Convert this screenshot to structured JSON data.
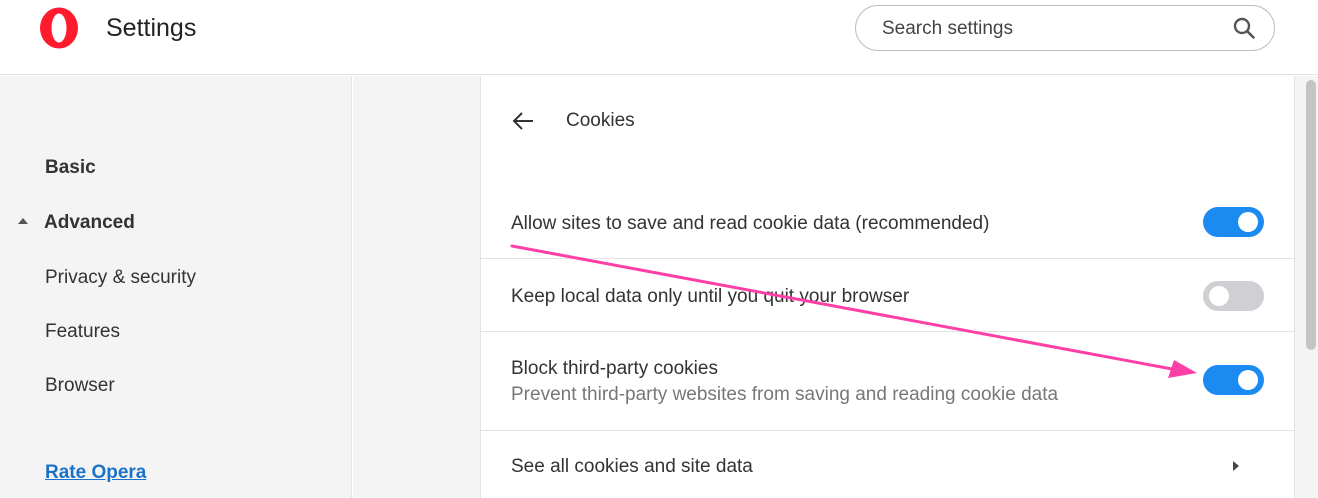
{
  "header": {
    "title": "Settings",
    "search": {
      "placeholder": "Search settings",
      "value": ""
    }
  },
  "sidebar": {
    "items": [
      {
        "label": "Basic"
      },
      {
        "label": "Advanced",
        "expanded": true
      },
      {
        "label": "Privacy & security"
      },
      {
        "label": "Features"
      },
      {
        "label": "Browser"
      }
    ],
    "rate_link": "Rate Opera"
  },
  "page": {
    "title": "Cookies",
    "settings": [
      {
        "label": "Allow sites to save and read cookie data (recommended)",
        "enabled": true
      },
      {
        "label": "Keep local data only until you quit your browser",
        "enabled": false
      },
      {
        "label": "Block third-party cookies",
        "description": "Prevent third-party websites from saving and reading cookie data",
        "enabled": true
      }
    ],
    "see_all_label": "See all cookies and site data"
  },
  "colors": {
    "accent": "#1b8bf2",
    "brand": "#ff1b2d",
    "annotation_arrow": "#ff3fa8",
    "link": "#1a73c9"
  },
  "icons": [
    "opera-logo-icon",
    "search-icon",
    "back-arrow-icon",
    "caret-up-icon",
    "chevron-right-icon"
  ]
}
